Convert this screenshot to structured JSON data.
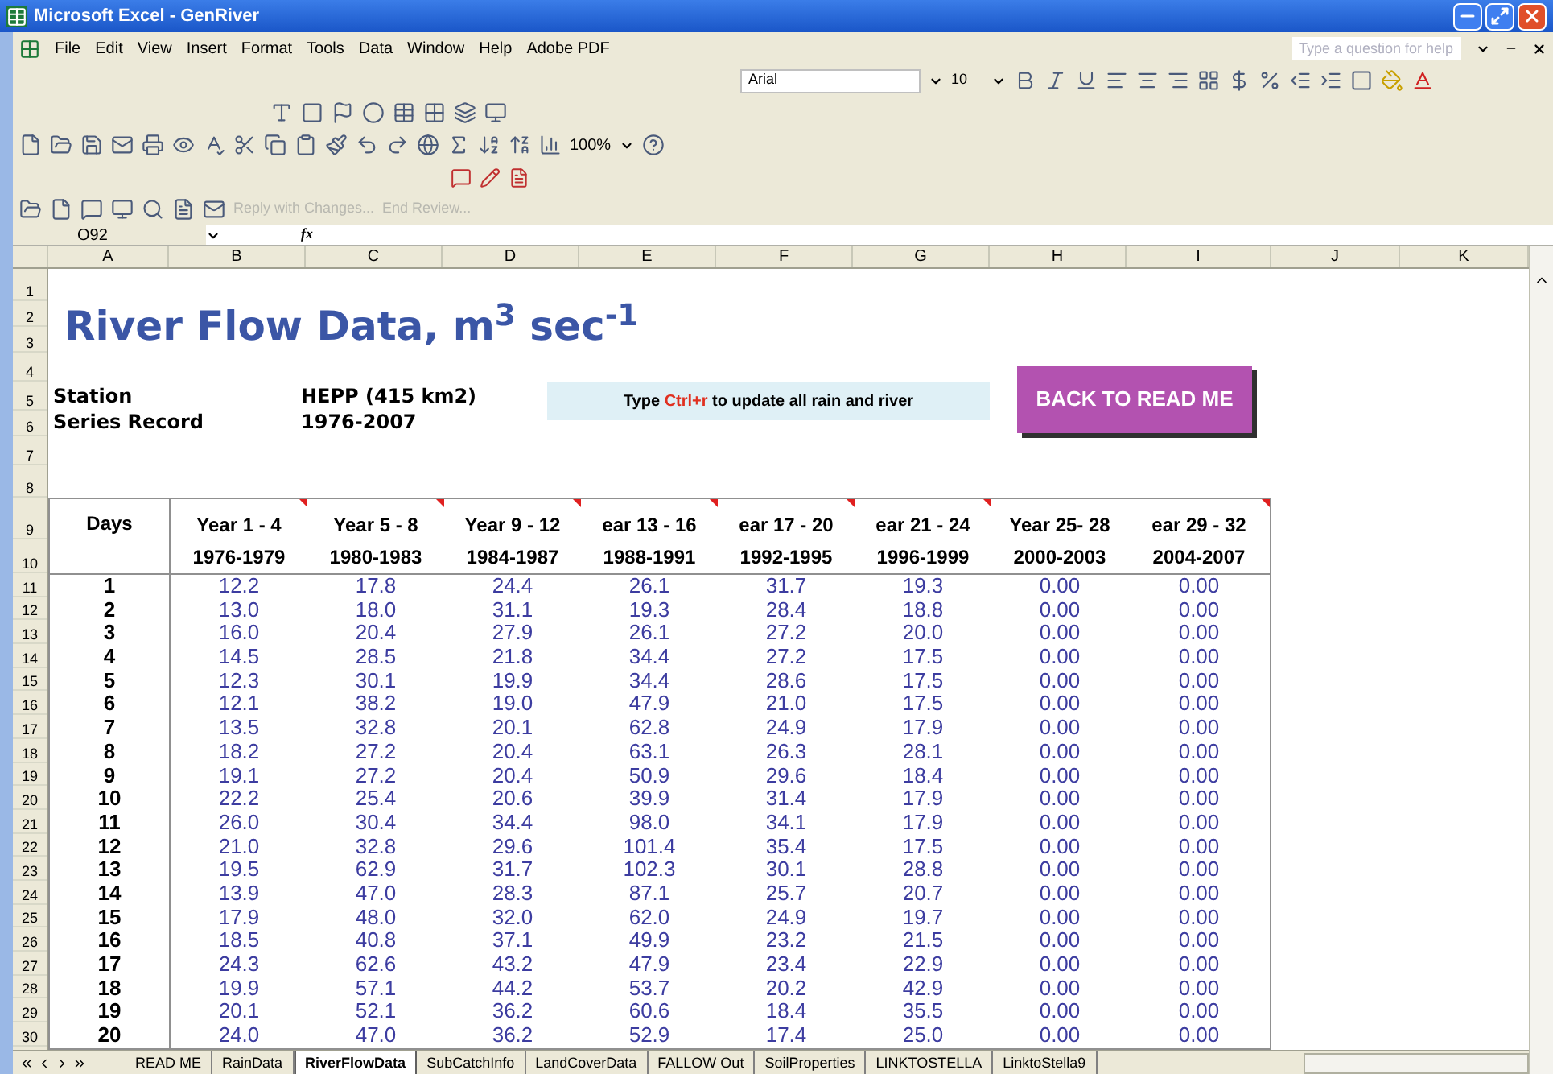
{
  "window": {
    "title": "Microsoft Excel - GenRiver"
  },
  "menu": [
    "File",
    "Edit",
    "View",
    "Insert",
    "Format",
    "Tools",
    "Data",
    "Window",
    "Help",
    "Adobe PDF"
  ],
  "help_box": {
    "placeholder": "Type a question for help"
  },
  "formatting_toolbar": {
    "font": "Arial",
    "size": "10"
  },
  "standard_toolbar": {
    "zoom": "100%"
  },
  "reviewing_toolbar": [
    {
      "label": "Reply with Changes...",
      "disabled": true
    },
    {
      "label": "End Review...",
      "disabled": true
    }
  ],
  "formula_bar": {
    "name_box": "O92",
    "fx": "fx"
  },
  "columns": [
    "A",
    "B",
    "C",
    "D",
    "E",
    "F",
    "G",
    "H",
    "I",
    "J",
    "K"
  ],
  "row_numbers": [
    "1",
    "2",
    "3",
    "4",
    "5",
    "6",
    "7",
    "8",
    "9",
    "10",
    "11",
    "12",
    "13",
    "14",
    "15",
    "16",
    "17",
    "18",
    "19",
    "20",
    "21",
    "22",
    "23",
    "24",
    "25",
    "26",
    "27",
    "28",
    "29",
    "30"
  ],
  "sheet": {
    "title": "River Flow Data, m$^{3}$ sec$^{-1}$",
    "info": [
      {
        "label": "Station",
        "value": "HEPP (415 km2)"
      },
      {
        "label": "Series Record",
        "value": "1976-2007"
      }
    ],
    "hint": {
      "before": "Type ",
      "key": "Ctrl+r",
      "after": " to update all rain and river"
    },
    "button": "BACK TO READ ME",
    "table": {
      "days_header": "Days",
      "columns": [
        {
          "period": "Year 1 - 4",
          "years": "1976-1979",
          "comment": true
        },
        {
          "period": "Year 5 - 8",
          "years": "1980-1983",
          "comment": true
        },
        {
          "period": "Year 9 - 12",
          "years": "1984-1987",
          "comment": true
        },
        {
          "period": "ear 13 - 16",
          "years": "1988-1991",
          "comment": true
        },
        {
          "period": "ear 17 - 20",
          "years": "1992-1995",
          "comment": true
        },
        {
          "period": "ear 21 - 24",
          "years": "1996-1999",
          "comment": true
        },
        {
          "period": "Year 25- 28",
          "years": "2000-2003",
          "comment": false
        },
        {
          "period": "ear 29 - 32",
          "years": "2004-2007",
          "comment": true
        }
      ],
      "rows": [
        {
          "day": "1",
          "values": [
            "12.2",
            "17.8",
            "24.4",
            "26.1",
            "31.7",
            "19.3",
            "0.00",
            "0.00"
          ]
        },
        {
          "day": "2",
          "values": [
            "13.0",
            "18.0",
            "31.1",
            "19.3",
            "28.4",
            "18.8",
            "0.00",
            "0.00"
          ]
        },
        {
          "day": "3",
          "values": [
            "16.0",
            "20.4",
            "27.9",
            "26.1",
            "27.2",
            "20.0",
            "0.00",
            "0.00"
          ]
        },
        {
          "day": "4",
          "values": [
            "14.5",
            "28.5",
            "21.8",
            "34.4",
            "27.2",
            "17.5",
            "0.00",
            "0.00"
          ]
        },
        {
          "day": "5",
          "values": [
            "12.3",
            "30.1",
            "19.9",
            "34.4",
            "28.6",
            "17.5",
            "0.00",
            "0.00"
          ]
        },
        {
          "day": "6",
          "values": [
            "12.1",
            "38.2",
            "19.0",
            "47.9",
            "21.0",
            "17.5",
            "0.00",
            "0.00"
          ]
        },
        {
          "day": "7",
          "values": [
            "13.5",
            "32.8",
            "20.1",
            "62.8",
            "24.9",
            "17.9",
            "0.00",
            "0.00"
          ]
        },
        {
          "day": "8",
          "values": [
            "18.2",
            "27.2",
            "20.4",
            "63.1",
            "26.3",
            "28.1",
            "0.00",
            "0.00"
          ]
        },
        {
          "day": "9",
          "values": [
            "19.1",
            "27.2",
            "20.4",
            "50.9",
            "29.6",
            "18.4",
            "0.00",
            "0.00"
          ]
        },
        {
          "day": "10",
          "values": [
            "22.2",
            "25.4",
            "20.6",
            "39.9",
            "31.4",
            "17.9",
            "0.00",
            "0.00"
          ]
        },
        {
          "day": "11",
          "values": [
            "26.0",
            "30.4",
            "34.4",
            "98.0",
            "34.1",
            "17.9",
            "0.00",
            "0.00"
          ]
        },
        {
          "day": "12",
          "values": [
            "21.0",
            "32.8",
            "29.6",
            "101.4",
            "35.4",
            "17.5",
            "0.00",
            "0.00"
          ]
        },
        {
          "day": "13",
          "values": [
            "19.5",
            "62.9",
            "31.7",
            "102.3",
            "30.1",
            "28.8",
            "0.00",
            "0.00"
          ]
        },
        {
          "day": "14",
          "values": [
            "13.9",
            "47.0",
            "28.3",
            "87.1",
            "25.7",
            "20.7",
            "0.00",
            "0.00"
          ]
        },
        {
          "day": "15",
          "values": [
            "17.9",
            "48.0",
            "32.0",
            "62.0",
            "24.9",
            "19.7",
            "0.00",
            "0.00"
          ]
        },
        {
          "day": "16",
          "values": [
            "18.5",
            "40.8",
            "37.1",
            "49.9",
            "23.2",
            "21.5",
            "0.00",
            "0.00"
          ]
        },
        {
          "day": "17",
          "values": [
            "24.3",
            "62.6",
            "43.2",
            "47.9",
            "23.4",
            "22.9",
            "0.00",
            "0.00"
          ]
        },
        {
          "day": "18",
          "values": [
            "19.9",
            "57.1",
            "44.2",
            "53.7",
            "20.2",
            "42.9",
            "0.00",
            "0.00"
          ]
        },
        {
          "day": "19",
          "values": [
            "20.1",
            "52.1",
            "36.2",
            "60.6",
            "18.4",
            "35.5",
            "0.00",
            "0.00"
          ]
        },
        {
          "day": "20",
          "values": [
            "24.0",
            "47.0",
            "36.2",
            "52.9",
            "17.4",
            "25.0",
            "0.00",
            "0.00"
          ]
        }
      ]
    }
  },
  "sheet_tabs": [
    {
      "label": "READ ME",
      "selected": false
    },
    {
      "label": "RainData",
      "selected": false
    },
    {
      "label": "RiverFlowData",
      "selected": true
    },
    {
      "label": "SubCatchInfo",
      "selected": false
    },
    {
      "label": "LandCoverData",
      "selected": false
    },
    {
      "label": "FALLOW Out",
      "selected": false
    },
    {
      "label": "SoilProperties",
      "selected": false
    },
    {
      "label": "LINKTOSTELLA",
      "selected": false
    },
    {
      "label": "LinktoStella9",
      "selected": false
    }
  ]
}
